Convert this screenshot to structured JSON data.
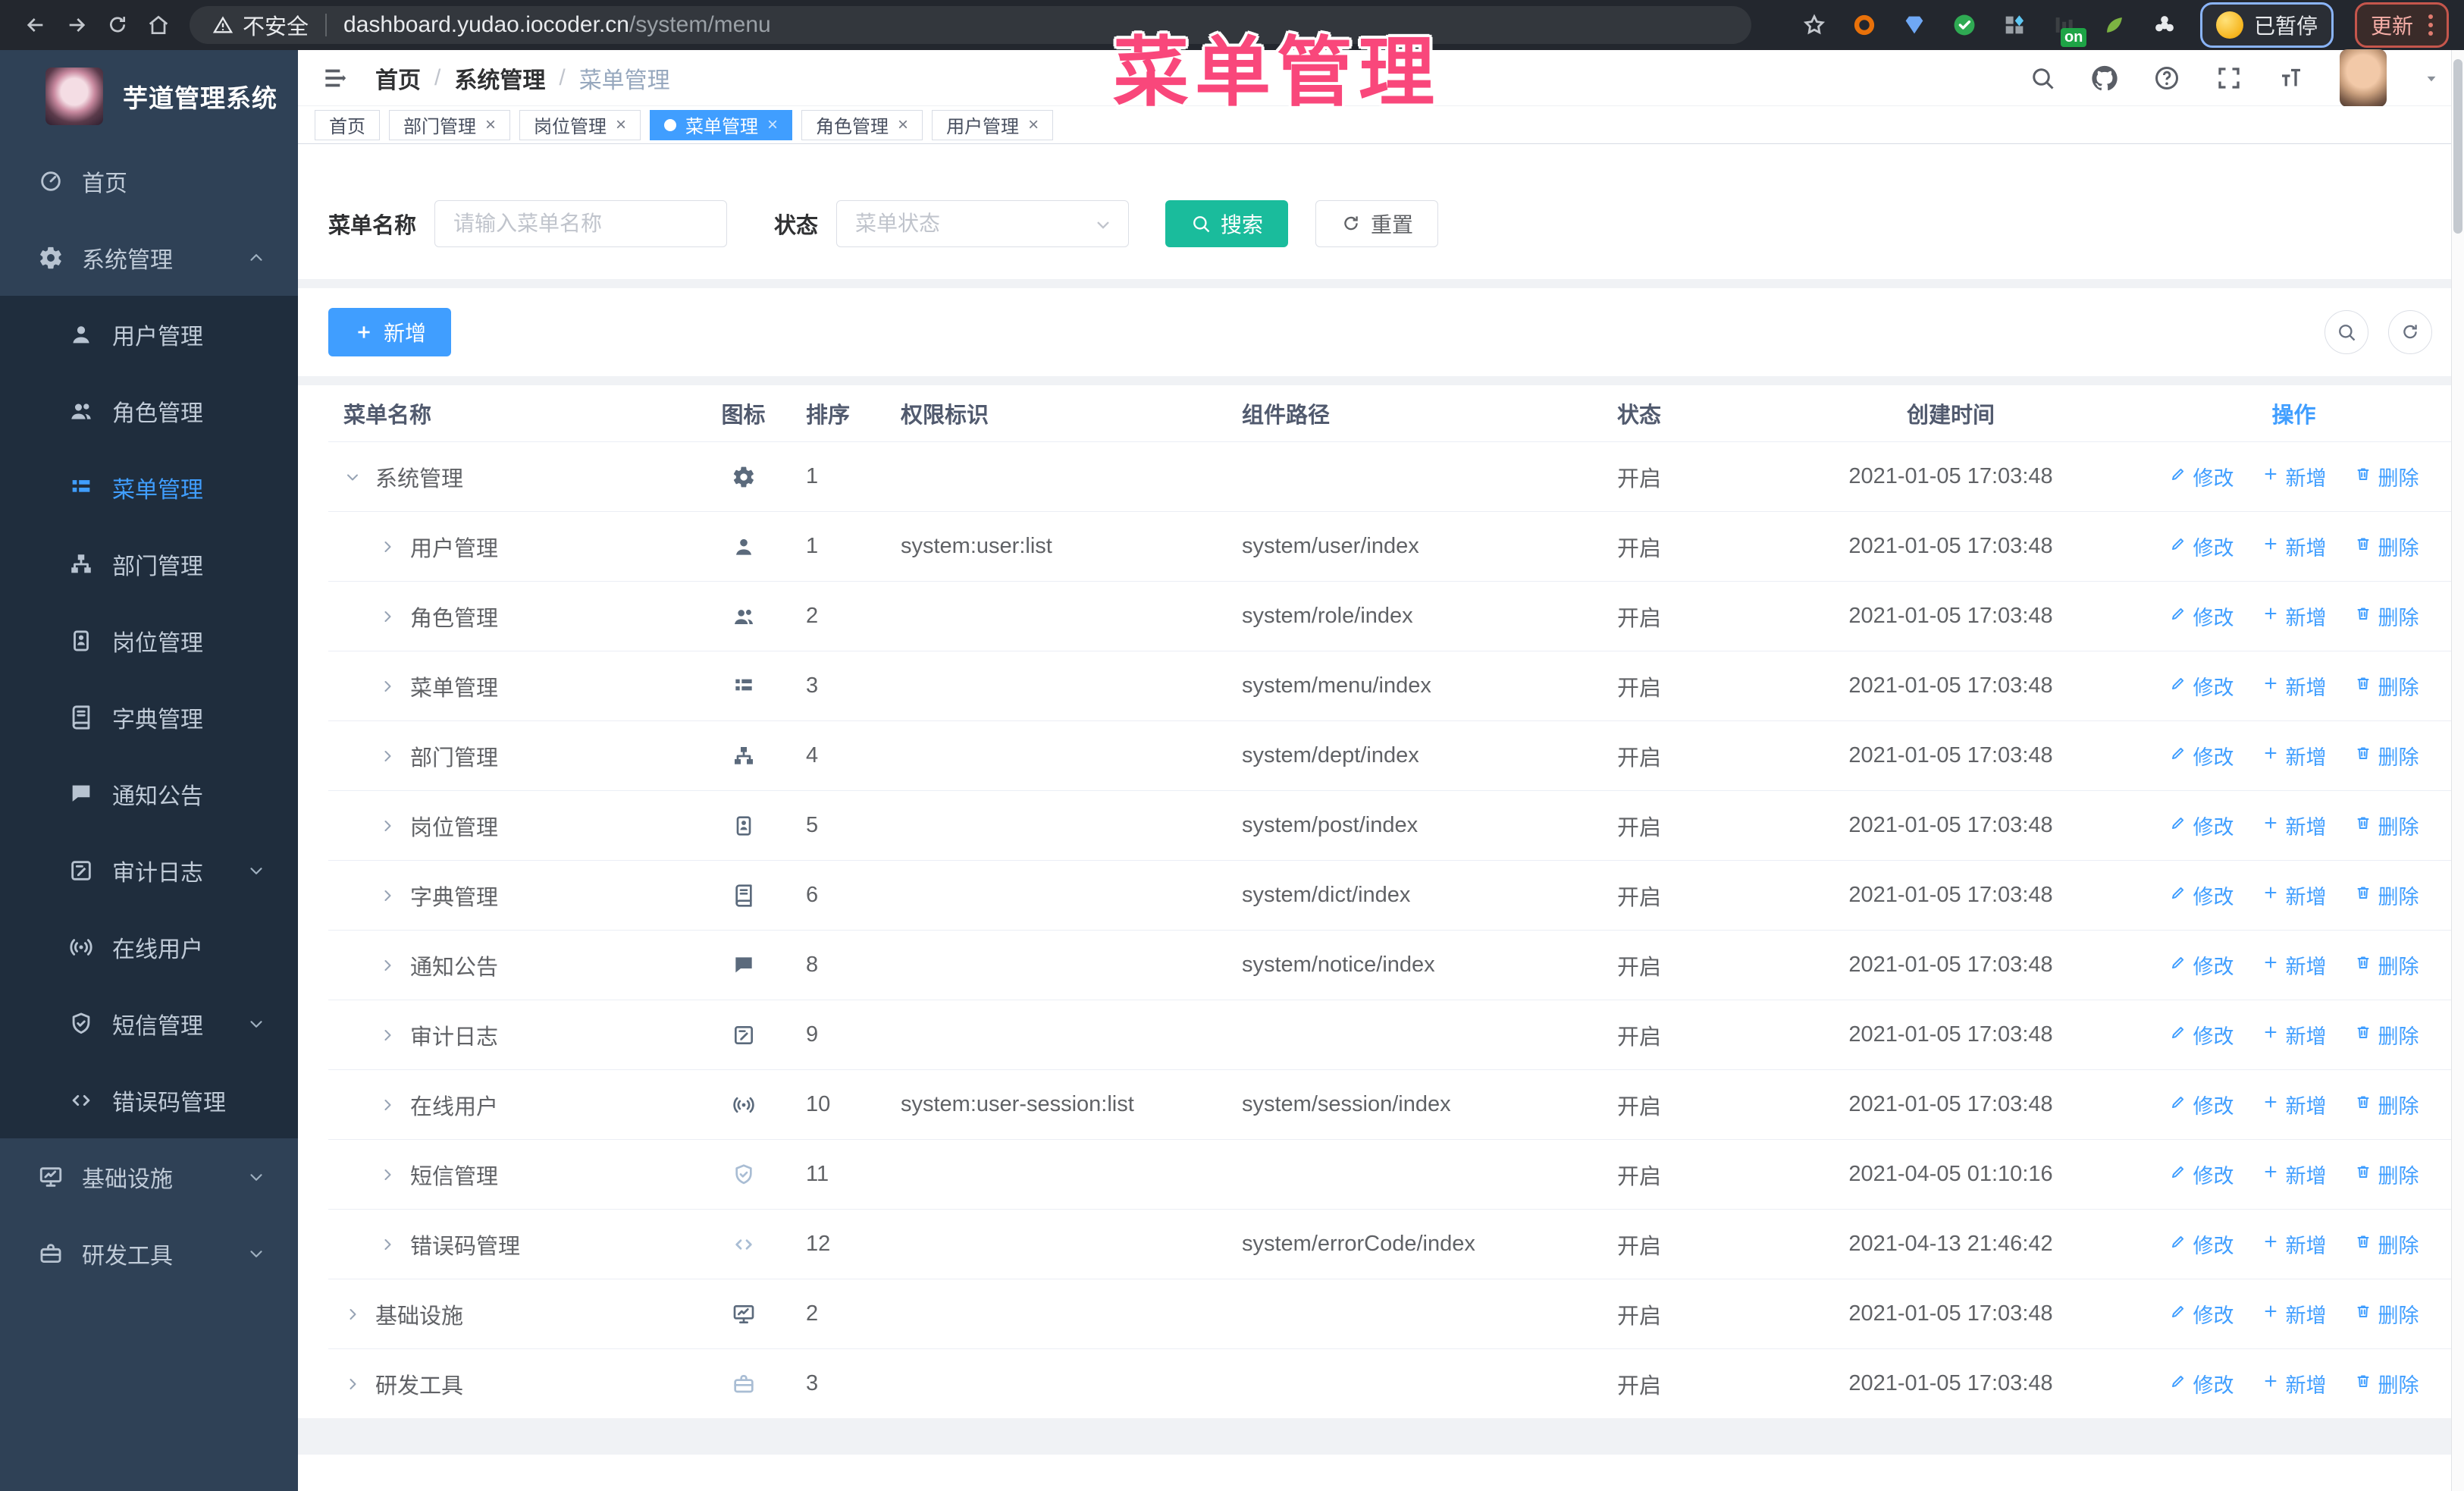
{
  "colors": {
    "primary": "#409eff",
    "teal": "#1abc9c",
    "sidebar_bg": "#2f4156",
    "submenu_bg": "#1f2d3d",
    "overlay_pink": "#f9477b",
    "active_tab": "#409eff"
  },
  "overlay_title": "菜单管理",
  "browser": {
    "security_label": "不安全",
    "url_host": "dashboard.yudao.iocoder.cn",
    "url_path": "/system/menu",
    "on_badge": "on",
    "paused_label": "已暂停",
    "update_label": "更新",
    "extensions": [
      {
        "icon": "ring",
        "color": "#e8710a"
      },
      {
        "icon": "gem",
        "color": "#6fa8f5"
      },
      {
        "icon": "check",
        "color": "#2faa53"
      },
      {
        "icon": "dotgrid",
        "color": "#9aa0a6"
      },
      {
        "icon": "barchart",
        "color": "#3c4043",
        "badge": "on"
      },
      {
        "icon": "leaf",
        "color": "#7cb342"
      },
      {
        "icon": "puzzle",
        "color": "#e8eaed"
      }
    ]
  },
  "sidebar": {
    "logo_title": "芋道管理系统",
    "items": [
      {
        "label": "首页",
        "icon": "home",
        "type": "top"
      },
      {
        "label": "系统管理",
        "icon": "gear",
        "type": "top",
        "chevron": "up"
      },
      {
        "label": "用户管理",
        "icon": "user",
        "type": "sub"
      },
      {
        "label": "角色管理",
        "icon": "users",
        "type": "sub"
      },
      {
        "label": "菜单管理",
        "icon": "menu",
        "type": "sub",
        "active": true
      },
      {
        "label": "部门管理",
        "icon": "tree",
        "type": "sub"
      },
      {
        "label": "岗位管理",
        "icon": "badge",
        "type": "sub"
      },
      {
        "label": "字典管理",
        "icon": "book",
        "type": "sub"
      },
      {
        "label": "通知公告",
        "icon": "message",
        "type": "sub"
      },
      {
        "label": "审计日志",
        "icon": "log",
        "type": "sub",
        "chevron": "down"
      },
      {
        "label": "在线用户",
        "icon": "online",
        "type": "sub"
      },
      {
        "label": "短信管理",
        "icon": "shield",
        "type": "sub",
        "chevron": "down"
      },
      {
        "label": "错误码管理",
        "icon": "code",
        "type": "sub"
      },
      {
        "label": "基础设施",
        "icon": "monitor",
        "type": "top",
        "chevron": "down"
      },
      {
        "label": "研发工具",
        "icon": "tool",
        "type": "top",
        "chevron": "down"
      }
    ]
  },
  "breadcrumb": {
    "separator": "/",
    "items": [
      "首页",
      "系统管理",
      "菜单管理"
    ]
  },
  "tabs": [
    {
      "label": "首页",
      "closable": false,
      "active": false
    },
    {
      "label": "部门管理",
      "closable": true,
      "active": false
    },
    {
      "label": "岗位管理",
      "closable": true,
      "active": false
    },
    {
      "label": "菜单管理",
      "closable": true,
      "active": true
    },
    {
      "label": "角色管理",
      "closable": true,
      "active": false
    },
    {
      "label": "用户管理",
      "closable": true,
      "active": false
    }
  ],
  "filters": {
    "name_label": "菜单名称",
    "name_placeholder": "请输入菜单名称",
    "status_label": "状态",
    "status_placeholder": "菜单状态",
    "search_label": "搜索",
    "reset_label": "重置"
  },
  "toolbar": {
    "add_label": "新增"
  },
  "table": {
    "columns": [
      "菜单名称",
      "图标",
      "排序",
      "权限标识",
      "组件路径",
      "状态",
      "创建时间",
      "操作"
    ],
    "action_labels": [
      "修改",
      "新增",
      "删除"
    ],
    "rows": [
      {
        "name": "系统管理",
        "level": 0,
        "expanded": true,
        "icon": "gear",
        "sort": "1",
        "perm": "",
        "path": "",
        "status": "开启",
        "time": "2021-01-05 17:03:48"
      },
      {
        "name": "用户管理",
        "level": 1,
        "expanded": false,
        "icon": "user",
        "sort": "1",
        "perm": "system:user:list",
        "path": "system/user/index",
        "status": "开启",
        "time": "2021-01-05 17:03:48"
      },
      {
        "name": "角色管理",
        "level": 1,
        "expanded": false,
        "icon": "users",
        "sort": "2",
        "perm": "",
        "path": "system/role/index",
        "status": "开启",
        "time": "2021-01-05 17:03:48"
      },
      {
        "name": "菜单管理",
        "level": 1,
        "expanded": false,
        "icon": "menu",
        "sort": "3",
        "perm": "",
        "path": "system/menu/index",
        "status": "开启",
        "time": "2021-01-05 17:03:48"
      },
      {
        "name": "部门管理",
        "level": 1,
        "expanded": false,
        "icon": "tree",
        "sort": "4",
        "perm": "",
        "path": "system/dept/index",
        "status": "开启",
        "time": "2021-01-05 17:03:48"
      },
      {
        "name": "岗位管理",
        "level": 1,
        "expanded": false,
        "icon": "badge",
        "sort": "5",
        "perm": "",
        "path": "system/post/index",
        "status": "开启",
        "time": "2021-01-05 17:03:48"
      },
      {
        "name": "字典管理",
        "level": 1,
        "expanded": false,
        "icon": "book",
        "sort": "6",
        "perm": "",
        "path": "system/dict/index",
        "status": "开启",
        "time": "2021-01-05 17:03:48"
      },
      {
        "name": "通知公告",
        "level": 1,
        "expanded": false,
        "icon": "message",
        "sort": "8",
        "perm": "",
        "path": "system/notice/index",
        "status": "开启",
        "time": "2021-01-05 17:03:48"
      },
      {
        "name": "审计日志",
        "level": 1,
        "expanded": false,
        "icon": "log",
        "sort": "9",
        "perm": "",
        "path": "",
        "status": "开启",
        "time": "2021-01-05 17:03:48"
      },
      {
        "name": "在线用户",
        "level": 1,
        "expanded": false,
        "icon": "online",
        "sort": "10",
        "perm": "system:user-session:list",
        "path": "system/session/index",
        "status": "开启",
        "time": "2021-01-05 17:03:48"
      },
      {
        "name": "短信管理",
        "level": 1,
        "expanded": false,
        "icon": "shield",
        "light": true,
        "sort": "11",
        "perm": "",
        "path": "",
        "status": "开启",
        "time": "2021-04-05 01:10:16"
      },
      {
        "name": "错误码管理",
        "level": 1,
        "expanded": false,
        "icon": "code",
        "light": true,
        "sort": "12",
        "perm": "",
        "path": "system/errorCode/index",
        "status": "开启",
        "time": "2021-04-13 21:46:42"
      },
      {
        "name": "基础设施",
        "level": 0,
        "expanded": false,
        "icon": "monitor",
        "sort": "2",
        "perm": "",
        "path": "",
        "status": "开启",
        "time": "2021-01-05 17:03:48"
      },
      {
        "name": "研发工具",
        "level": 0,
        "expanded": false,
        "icon": "tool",
        "light": true,
        "sort": "3",
        "perm": "",
        "path": "",
        "status": "开启",
        "time": "2021-01-05 17:03:48"
      }
    ]
  }
}
